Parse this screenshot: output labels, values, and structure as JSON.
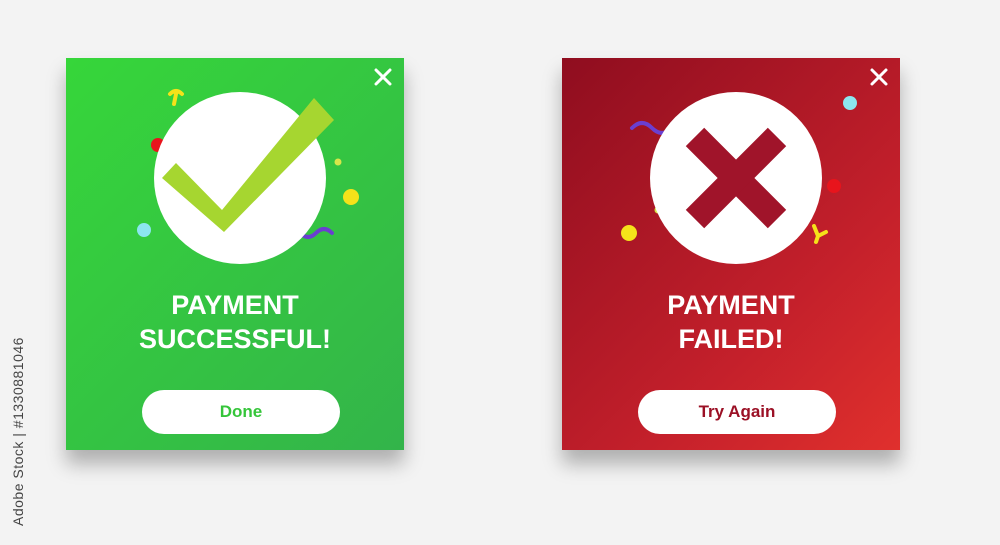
{
  "watermark_id": "Adobe Stock | #1330881046",
  "success_card": {
    "title_line1": "PAYMENT",
    "title_line2": "SUCCESSFUL!",
    "button_label": "Done",
    "icon": "checkmark-icon",
    "close_icon": "close-icon",
    "bg_colors": [
      "#36d63a",
      "#33b44a"
    ],
    "accent_color": "#a6d630"
  },
  "failed_card": {
    "title_line1": "PAYMENT",
    "title_line2": "FAILED!",
    "button_label": "Try Again",
    "icon": "cross-icon",
    "close_icon": "close-icon",
    "bg_colors": [
      "#8f0d1f",
      "#e0302d"
    ],
    "accent_color": "#a0142a"
  }
}
